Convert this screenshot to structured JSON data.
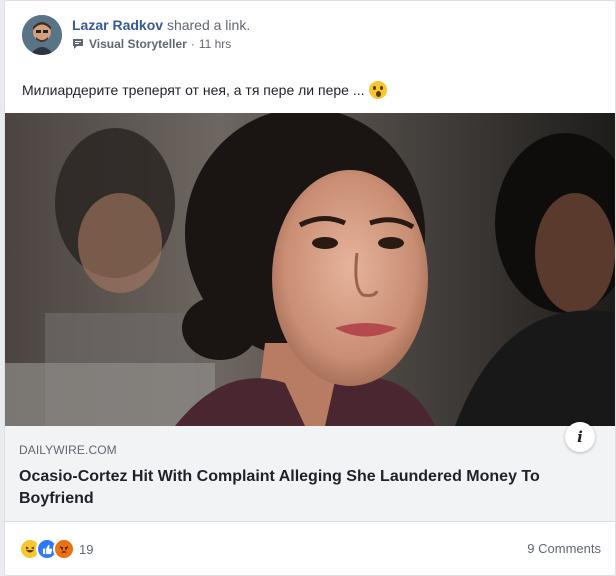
{
  "post": {
    "author_name": "Lazar Radkov",
    "action": "shared a link.",
    "page_name": "Visual Storyteller",
    "separator": "·",
    "time": "11 hrs",
    "text": "Милиардерите треперят от нея, а тя пере ли пере ..."
  },
  "link": {
    "domain": "DAILYWIRE.COM",
    "headline": "Ocasio-Cortez Hit With Complaint Alleging She Laundered Money To Boyfriend",
    "info_label": "i"
  },
  "footer": {
    "reaction_count": "19",
    "comments": "9 Comments",
    "reaction_icons": [
      "haha-icon",
      "like-icon",
      "angry-icon"
    ]
  },
  "colors": {
    "author": "#385898",
    "text": "#1d2129",
    "muted": "#606770",
    "link_bg": "#f2f3f5"
  }
}
